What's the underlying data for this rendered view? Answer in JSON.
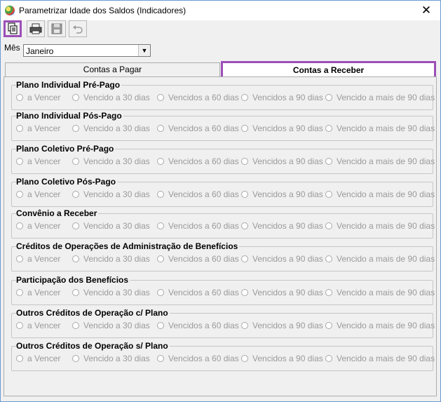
{
  "window": {
    "title": "Parametrizar Idade dos Saldos (Indicadores)",
    "close_glyph": "✕"
  },
  "toolbar": {
    "buttons": [
      "copy-icon",
      "print-icon",
      "save-icon",
      "undo-icon"
    ]
  },
  "filter": {
    "label": "Mês",
    "selected": "Janeiro"
  },
  "tabs": [
    {
      "label": "Contas a Pagar",
      "active": false
    },
    {
      "label": "Contas a Receber",
      "active": true
    }
  ],
  "options": [
    "a Vencer",
    "Vencido a 30 dias",
    "Vencidos a 60 dias",
    "Vencidos a 90 dias",
    "Vencido a mais de 90 dias"
  ],
  "groups": [
    {
      "title": "Plano Individual Pré-Pago"
    },
    {
      "title": "Plano Individual Pós-Pago"
    },
    {
      "title": "Plano Coletivo Pré-Pago"
    },
    {
      "title": "Plano Coletivo Pós-Pago"
    },
    {
      "title": "Convênio a Receber"
    },
    {
      "title": "Créditos de Operações de Administração de Benefícios"
    },
    {
      "title": "Participação dos Benefícios"
    },
    {
      "title": "Outros Créditos de Operação c/ Plano"
    },
    {
      "title": "Outros Créditos de Operação s/ Plano"
    }
  ],
  "colors": {
    "highlight": "#9c4fb8",
    "disabled_text": "#9a9a9a"
  }
}
